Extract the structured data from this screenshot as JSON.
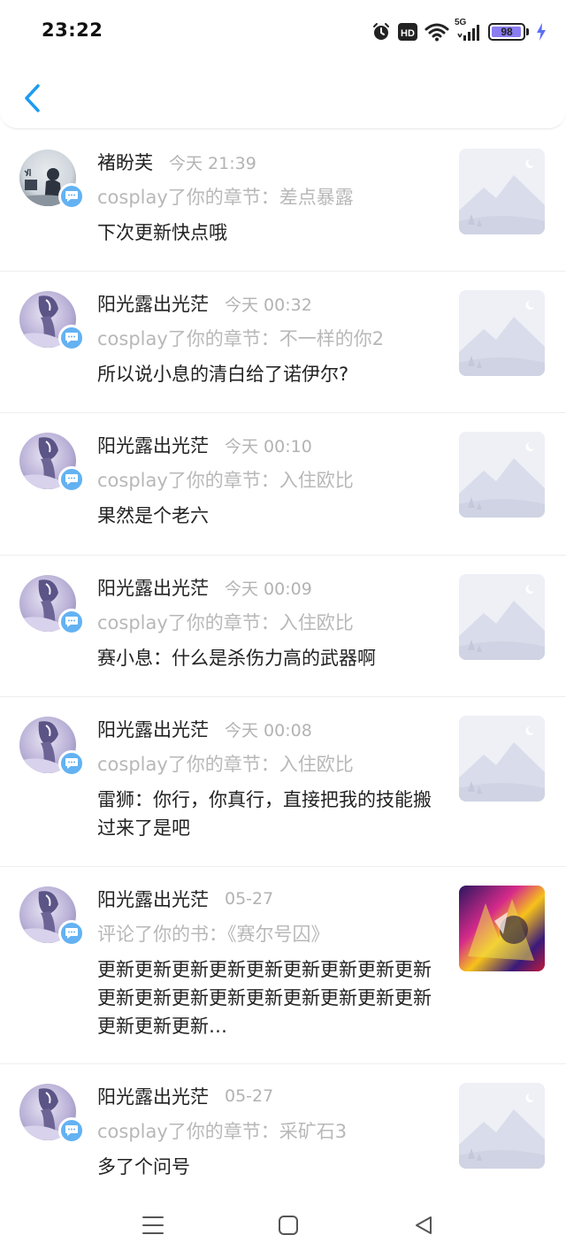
{
  "status_bar": {
    "time": "23:22",
    "network": "5G",
    "battery": "98",
    "battery_level": 0.98,
    "icons": [
      "alarm-icon",
      "hd-icon",
      "wifi-icon",
      "signal-icon",
      "battery-icon",
      "charging-icon"
    ]
  },
  "header": {
    "back_icon": "chevron-left-icon",
    "accent_color": "#1e9bf0"
  },
  "notifications": [
    {
      "name": "褚盼芙",
      "time": "今天 21:39",
      "action": "cosplay了你的章节：差点暴露",
      "comment": "下次更新快点哦",
      "avatar": "avatar-a",
      "thumb": "placeholder"
    },
    {
      "name": "阳光露出光茫",
      "time": "今天 00:32",
      "action": "cosplay了你的章节：不一样的你2",
      "comment": "所以说小息的清白给了诺伊尔?",
      "avatar": "avatar-b",
      "thumb": "placeholder"
    },
    {
      "name": "阳光露出光茫",
      "time": "今天 00:10",
      "action": "cosplay了你的章节：入住欧比",
      "comment": "果然是个老六",
      "avatar": "avatar-b",
      "thumb": "placeholder"
    },
    {
      "name": "阳光露出光茫",
      "time": "今天 00:09",
      "action": "cosplay了你的章节：入住欧比",
      "comment": "赛小息：什么是杀伤力高的武器啊",
      "avatar": "avatar-b",
      "thumb": "placeholder"
    },
    {
      "name": "阳光露出光茫",
      "time": "今天 00:08",
      "action": "cosplay了你的章节：入住欧比",
      "comment": "雷狮：你行，你真行，直接把我的技能搬过来了是吧",
      "avatar": "avatar-b",
      "thumb": "placeholder"
    },
    {
      "name": "阳光露出光茫",
      "time": "05-27",
      "action": "评论了你的书：《赛尔号囚》",
      "comment": "更新更新更新更新更新更新更新更新更新更新更新更新更新更新更新更新更新更新更新更新更新…",
      "avatar": "avatar-b",
      "thumb": "cover"
    },
    {
      "name": "阳光露出光茫",
      "time": "05-27",
      "action": "cosplay了你的章节：采矿石3",
      "comment": "多了个问号",
      "avatar": "avatar-b",
      "thumb": "placeholder"
    }
  ],
  "nav_bar": {
    "icons": [
      "menu-icon",
      "home-square-icon",
      "back-triangle-icon"
    ]
  },
  "colors": {
    "badge": "#64b2f2",
    "muted_text": "#b8b8b8",
    "primary_text": "#222222"
  }
}
